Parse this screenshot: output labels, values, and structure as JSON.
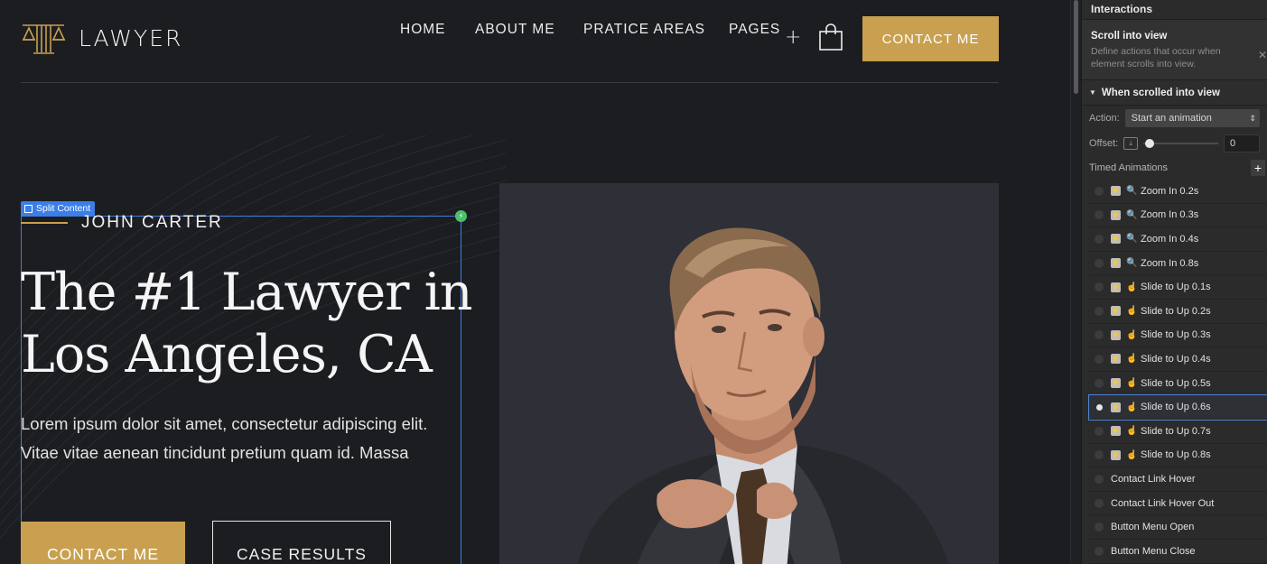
{
  "site": {
    "logo_text": "LAWYER",
    "nav": {
      "home": "HOME",
      "about": "ABOUT ME",
      "practice": "PRATICE AREAS",
      "pages": "PAGES",
      "pages_plus": "+",
      "contact": "CONTACT ME"
    },
    "selection_label": "Split Content",
    "hero": {
      "eyebrow": "JOHN CARTER",
      "title_line1": "The #1 Lawyer in",
      "title_line2": "Los Angeles, CA",
      "body_line1": "Lorem ipsum dolor sit amet, consectetur adipiscing elit.",
      "body_line2": "Vitae vitae aenean tincidunt pretium quam id. Massa",
      "primary_button": "CONTACT ME",
      "secondary_button": "CASE RESULTS"
    },
    "colors": {
      "accent": "#c9a04f",
      "background": "#1c1d21",
      "photo_bg": "#2e2f37"
    }
  },
  "panel": {
    "title": "Interactions",
    "trigger": {
      "title": "Scroll into view",
      "description": "Define actions that occur when element scrolls into view."
    },
    "section": "When scrolled into view",
    "action_label": "Action:",
    "action_value": "Start an animation",
    "offset_label": "Offset:",
    "offset_value": "0",
    "timed_label": "Timed Animations",
    "timed_add": "+",
    "timed": [
      {
        "label": "Zoom In 0.2s",
        "kind": "zoom"
      },
      {
        "label": "Zoom In 0.3s",
        "kind": "zoom"
      },
      {
        "label": "Zoom In 0.4s",
        "kind": "zoom"
      },
      {
        "label": "Zoom In 0.8s",
        "kind": "zoom"
      },
      {
        "label": "Slide to Up 0.1s",
        "kind": "slide"
      },
      {
        "label": "Slide to Up 0.2s",
        "kind": "slide"
      },
      {
        "label": "Slide to Up 0.3s",
        "kind": "slide"
      },
      {
        "label": "Slide to Up 0.4s",
        "kind": "slide"
      },
      {
        "label": "Slide to Up 0.5s",
        "kind": "slide"
      },
      {
        "label": "Slide to Up 0.6s",
        "kind": "slide",
        "active": true
      },
      {
        "label": "Slide to Up 0.7s",
        "kind": "slide"
      },
      {
        "label": "Slide to Up 0.8s",
        "kind": "slide"
      }
    ],
    "other": [
      "Contact Link Hover",
      "Contact Link Hover Out",
      "Button Menu Open",
      "Button Menu Close"
    ]
  }
}
